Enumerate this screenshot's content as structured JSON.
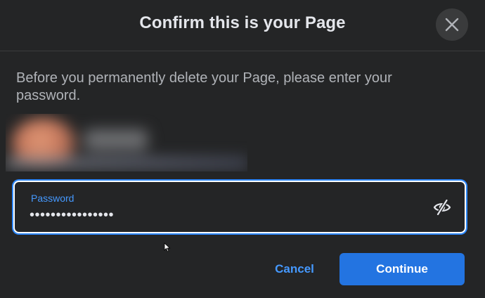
{
  "dialog": {
    "title": "Confirm this is your Page",
    "instructions": "Before you permanently delete your Page, please enter your password."
  },
  "password_field": {
    "label": "Password",
    "value": "••••••••••••••••"
  },
  "icons": {
    "close": "close-icon",
    "visibility_toggle": "eye-off-icon",
    "cursor": "mouse-pointer-icon"
  },
  "actions": {
    "cancel_label": "Cancel",
    "continue_label": "Continue"
  },
  "colors": {
    "background": "#242526",
    "accent": "#2374e1",
    "link": "#4599ff",
    "text_primary": "#e4e6eb",
    "text_secondary": "#b0b3b8"
  }
}
